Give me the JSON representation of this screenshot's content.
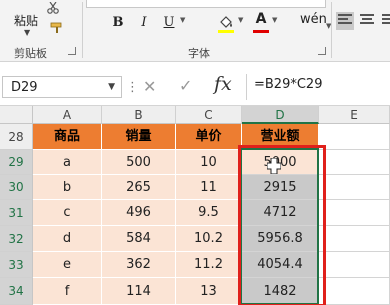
{
  "ribbon": {
    "paste_label": "粘贴",
    "clipboard_group": "剪贴板",
    "font_group": "字体",
    "bold": "B",
    "italic": "I",
    "underline": "U",
    "font_color_glyph": "A",
    "phonetic_glyph": "wén",
    "fill_color": "#ffff00",
    "font_color": "#e00000"
  },
  "formula_bar": {
    "name_box": "D29",
    "formula": "=B29*C29"
  },
  "columns": [
    "A",
    "B",
    "C",
    "D",
    "E"
  ],
  "rows": [
    {
      "num": "28",
      "cells": [
        "商品",
        "销量",
        "单价",
        "营业额"
      ]
    },
    {
      "num": "29",
      "cells": [
        "a",
        "500",
        "10",
        "5000"
      ]
    },
    {
      "num": "30",
      "cells": [
        "b",
        "265",
        "11",
        "2915"
      ]
    },
    {
      "num": "31",
      "cells": [
        "c",
        "496",
        "9.5",
        "4712"
      ]
    },
    {
      "num": "32",
      "cells": [
        "d",
        "584",
        "10.2",
        "5956.8"
      ]
    },
    {
      "num": "33",
      "cells": [
        "e",
        "362",
        "11.2",
        "4054.4"
      ]
    },
    {
      "num": "34",
      "cells": [
        "f",
        "114",
        "13",
        "1482"
      ]
    }
  ],
  "colors": {
    "header_fill": "#ed7d31",
    "body_fill": "#fbe4d5",
    "selection_green": "#217346",
    "highlight_red": "#e0201b"
  }
}
